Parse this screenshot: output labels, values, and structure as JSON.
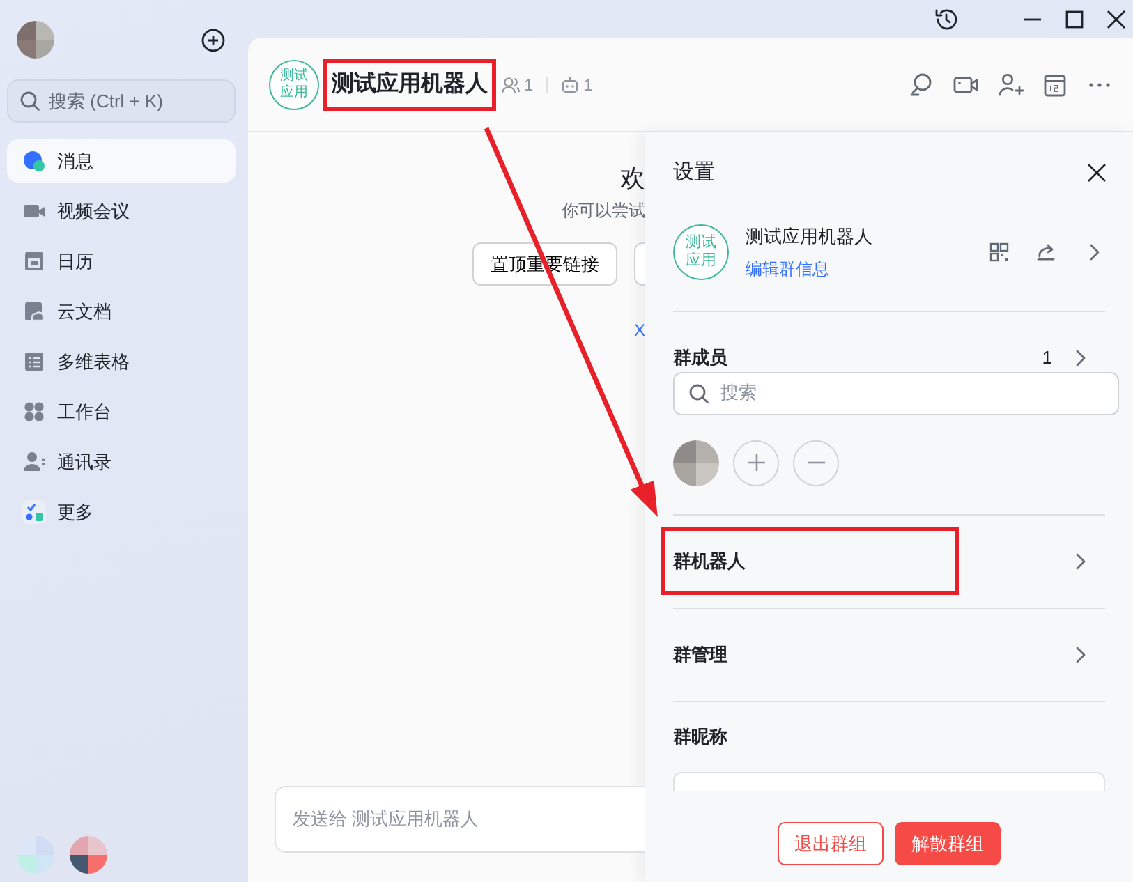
{
  "sidebar": {
    "search": {
      "placeholder": "搜索 (Ctrl + K)"
    },
    "items": [
      {
        "label": "消息",
        "selected": true
      },
      {
        "label": "视频会议",
        "selected": false
      },
      {
        "label": "日历",
        "selected": false
      },
      {
        "label": "云文档",
        "selected": false
      },
      {
        "label": "多维表格",
        "selected": false
      },
      {
        "label": "工作台",
        "selected": false
      },
      {
        "label": "通讯录",
        "selected": false
      },
      {
        "label": "更多",
        "selected": false
      }
    ]
  },
  "chat": {
    "avatar_lines": [
      "测试",
      "应用"
    ],
    "title": "测试应用机器人",
    "title_highlighted": true,
    "member_count": "1",
    "bot_count": "1",
    "welcome_title": "欢",
    "welcome_hint": "你可以尝试",
    "quick_actions": [
      "置顶重要链接"
    ],
    "link_text": "X",
    "input": {
      "placeholder": "发送给 测试应用机器人"
    }
  },
  "settings": {
    "title": "设置",
    "group": {
      "avatar_lines": [
        "测试",
        "应用"
      ],
      "name": "测试应用机器人",
      "edit_link": "编辑群信息"
    },
    "members": {
      "label": "群成员",
      "count": "1",
      "search_placeholder": "搜索"
    },
    "rows": [
      {
        "kind": "link",
        "label": "群机器人",
        "highlighted": true
      },
      {
        "kind": "link",
        "label": "群管理",
        "highlighted": false
      },
      {
        "kind": "field",
        "label": "群昵称"
      }
    ],
    "buttons": [
      {
        "label": "退出群组",
        "kind": "outline"
      },
      {
        "label": "解散群组",
        "kind": "danger"
      }
    ]
  },
  "annotation": {
    "arrow": true
  }
}
